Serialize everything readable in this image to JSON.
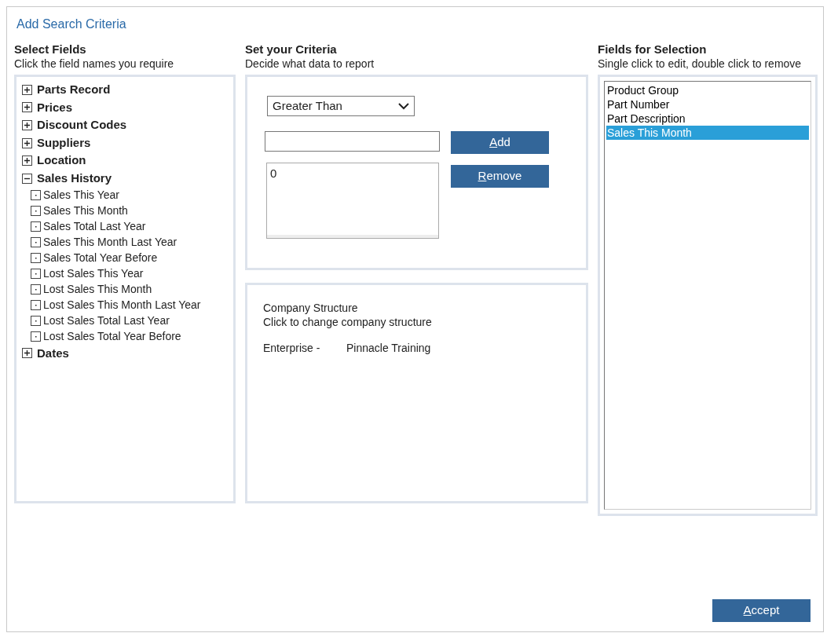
{
  "window": {
    "title": "Add Search Criteria"
  },
  "select_fields": {
    "heading": "Select Fields",
    "hint": "Click the field names you require",
    "tree": [
      {
        "label": "Parts Record",
        "expanded": false
      },
      {
        "label": "Prices",
        "expanded": false
      },
      {
        "label": "Discount Codes",
        "expanded": false
      },
      {
        "label": "Suppliers",
        "expanded": false
      },
      {
        "label": "Location",
        "expanded": false
      },
      {
        "label": "Sales History",
        "expanded": true,
        "children": [
          {
            "label": "Sales This Year"
          },
          {
            "label": "Sales This Month"
          },
          {
            "label": "Sales Total Last Year"
          },
          {
            "label": "Sales This Month Last Year"
          },
          {
            "label": "Sales Total Year Before"
          },
          {
            "label": "Lost Sales This Year"
          },
          {
            "label": "Lost Sales This Month"
          },
          {
            "label": "Lost Sales This Month Last Year"
          },
          {
            "label": "Lost Sales Total Last Year"
          },
          {
            "label": "Lost Sales Total Year Before"
          }
        ]
      },
      {
        "label": "Dates",
        "expanded": false
      }
    ]
  },
  "criteria": {
    "heading": "Set your Criteria",
    "hint": "Decide what data to report",
    "operator": "Greater Than",
    "values_list": [
      "0"
    ],
    "buttons": [
      {
        "label": "Add",
        "mnemonic_underlined": true
      },
      {
        "label": "Remove",
        "mnemonic_underlined": true
      }
    ]
  },
  "company": {
    "title": "Company Structure",
    "hint": "Click to change company structure",
    "level_label": "Enterprise -",
    "level_value": "Pinnacle Training"
  },
  "selection": {
    "heading": "Fields for Selection",
    "hint": "Single click to edit, double click to remove",
    "items": [
      {
        "label": "Product Group",
        "selected": false
      },
      {
        "label": "Part Number",
        "selected": false
      },
      {
        "label": "Part Description",
        "selected": false
      },
      {
        "label": "Sales This Month",
        "selected": true
      }
    ]
  },
  "footer": {
    "accept": {
      "label": "Accept",
      "mnemonic_underlined": true
    }
  }
}
